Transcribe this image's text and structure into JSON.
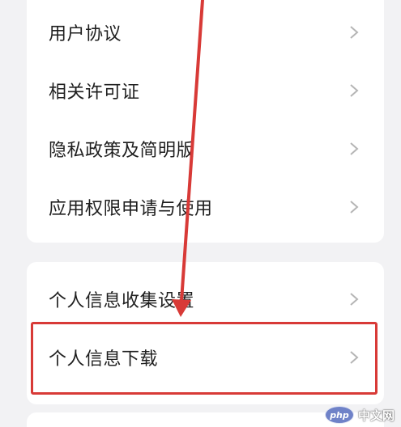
{
  "settings_group_1": {
    "items": [
      {
        "label": "用户协议",
        "icon": "chevron-right-icon"
      },
      {
        "label": "相关许可证",
        "icon": "chevron-right-icon"
      },
      {
        "label": "隐私政策及简明版",
        "icon": "chevron-right-icon"
      },
      {
        "label": "应用权限申请与使用",
        "icon": "chevron-right-icon"
      }
    ]
  },
  "settings_group_2": {
    "items": [
      {
        "label": "个人信息收集设置",
        "icon": "chevron-right-icon"
      },
      {
        "label": "个人信息下载",
        "icon": "chevron-right-icon",
        "highlighted": true
      }
    ]
  },
  "annotation": {
    "highlight_color": "#d83a37",
    "arrow_color": "#d83a37"
  },
  "watermark": {
    "logo_text": "php",
    "site_text": "中文网"
  },
  "colors": {
    "background": "#f2f2f4",
    "card": "#ffffff",
    "text": "#1f1f1f",
    "chevron": "#b5b5b5"
  }
}
